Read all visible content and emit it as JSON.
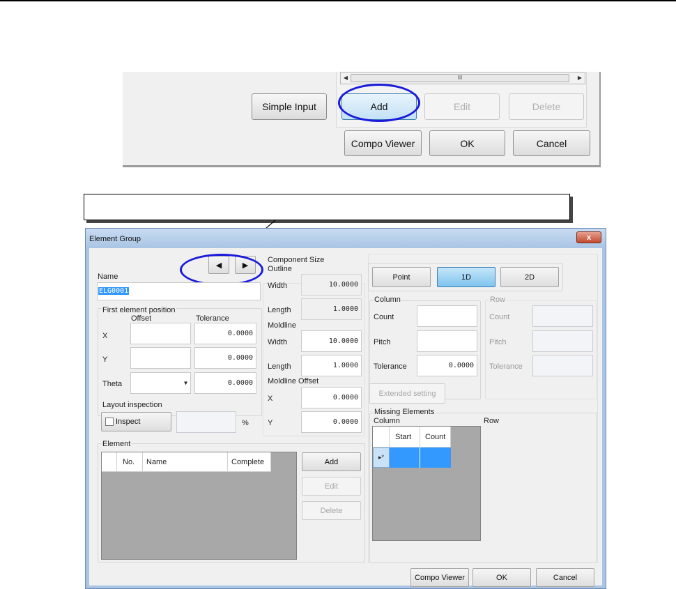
{
  "top_snippet": {
    "scrollbar_thumb": "III",
    "buttons": {
      "simple_input": "Simple Input",
      "add": "Add",
      "edit": "Edit",
      "delete": "Delete",
      "compo_viewer": "Compo Viewer",
      "ok": "OK",
      "cancel": "Cancel"
    }
  },
  "callout": {
    "text": ""
  },
  "dialog": {
    "title": "Element Group",
    "close": "x",
    "name_label": "Name",
    "name_value": "ELG0001",
    "first_pos": {
      "title": "First element position",
      "offset": "Offset",
      "tolerance": "Tolerance",
      "x": "X",
      "y": "Y",
      "theta": "Theta",
      "x_tol": "0.0000",
      "y_tol": "0.0000",
      "theta_tol": "0.0000"
    },
    "layout": {
      "title": "Layout inspection",
      "inspect": "Inspect",
      "pct": "%"
    },
    "component_size": {
      "title": "Component Size",
      "outline": "Outline",
      "width": "Width",
      "width_val": "10.0000",
      "length": "Length",
      "length_val": "1.0000",
      "moldline": "Moldline",
      "m_width": "Width",
      "m_width_val": "10.0000",
      "m_length": "Length",
      "m_length_val": "1.0000",
      "moldline_offset": "Moldline Offset",
      "ox": "X",
      "ox_val": "0.0000",
      "oy": "Y",
      "oy_val": "0.0000"
    },
    "modes": {
      "point": "Point",
      "d1": "1D",
      "d2": "2D"
    },
    "column": {
      "title": "Column",
      "count": "Count",
      "pitch": "Pitch",
      "tolerance": "Tolerance",
      "tol_val": "0.0000"
    },
    "row": {
      "title": "Row",
      "count": "Count",
      "pitch": "Pitch",
      "tolerance": "Tolerance"
    },
    "extended": "Extended setting",
    "missing": {
      "title": "Missing Elements",
      "column": "Column",
      "row": "Row",
      "start": "Start",
      "count": "Count",
      "new_row_marker": "▸*"
    },
    "element": {
      "title": "Element",
      "cols": [
        "No.",
        "Name",
        "Complete"
      ],
      "add": "Add",
      "edit": "Edit",
      "delete": "Delete"
    },
    "footer": {
      "compo_viewer": "Compo Viewer",
      "ok": "OK",
      "cancel": "Cancel"
    }
  },
  "colors": {
    "highlight_ring": "#1a1adb",
    "selected_mode": "#7fc4ee",
    "selection": "#3399ff"
  }
}
